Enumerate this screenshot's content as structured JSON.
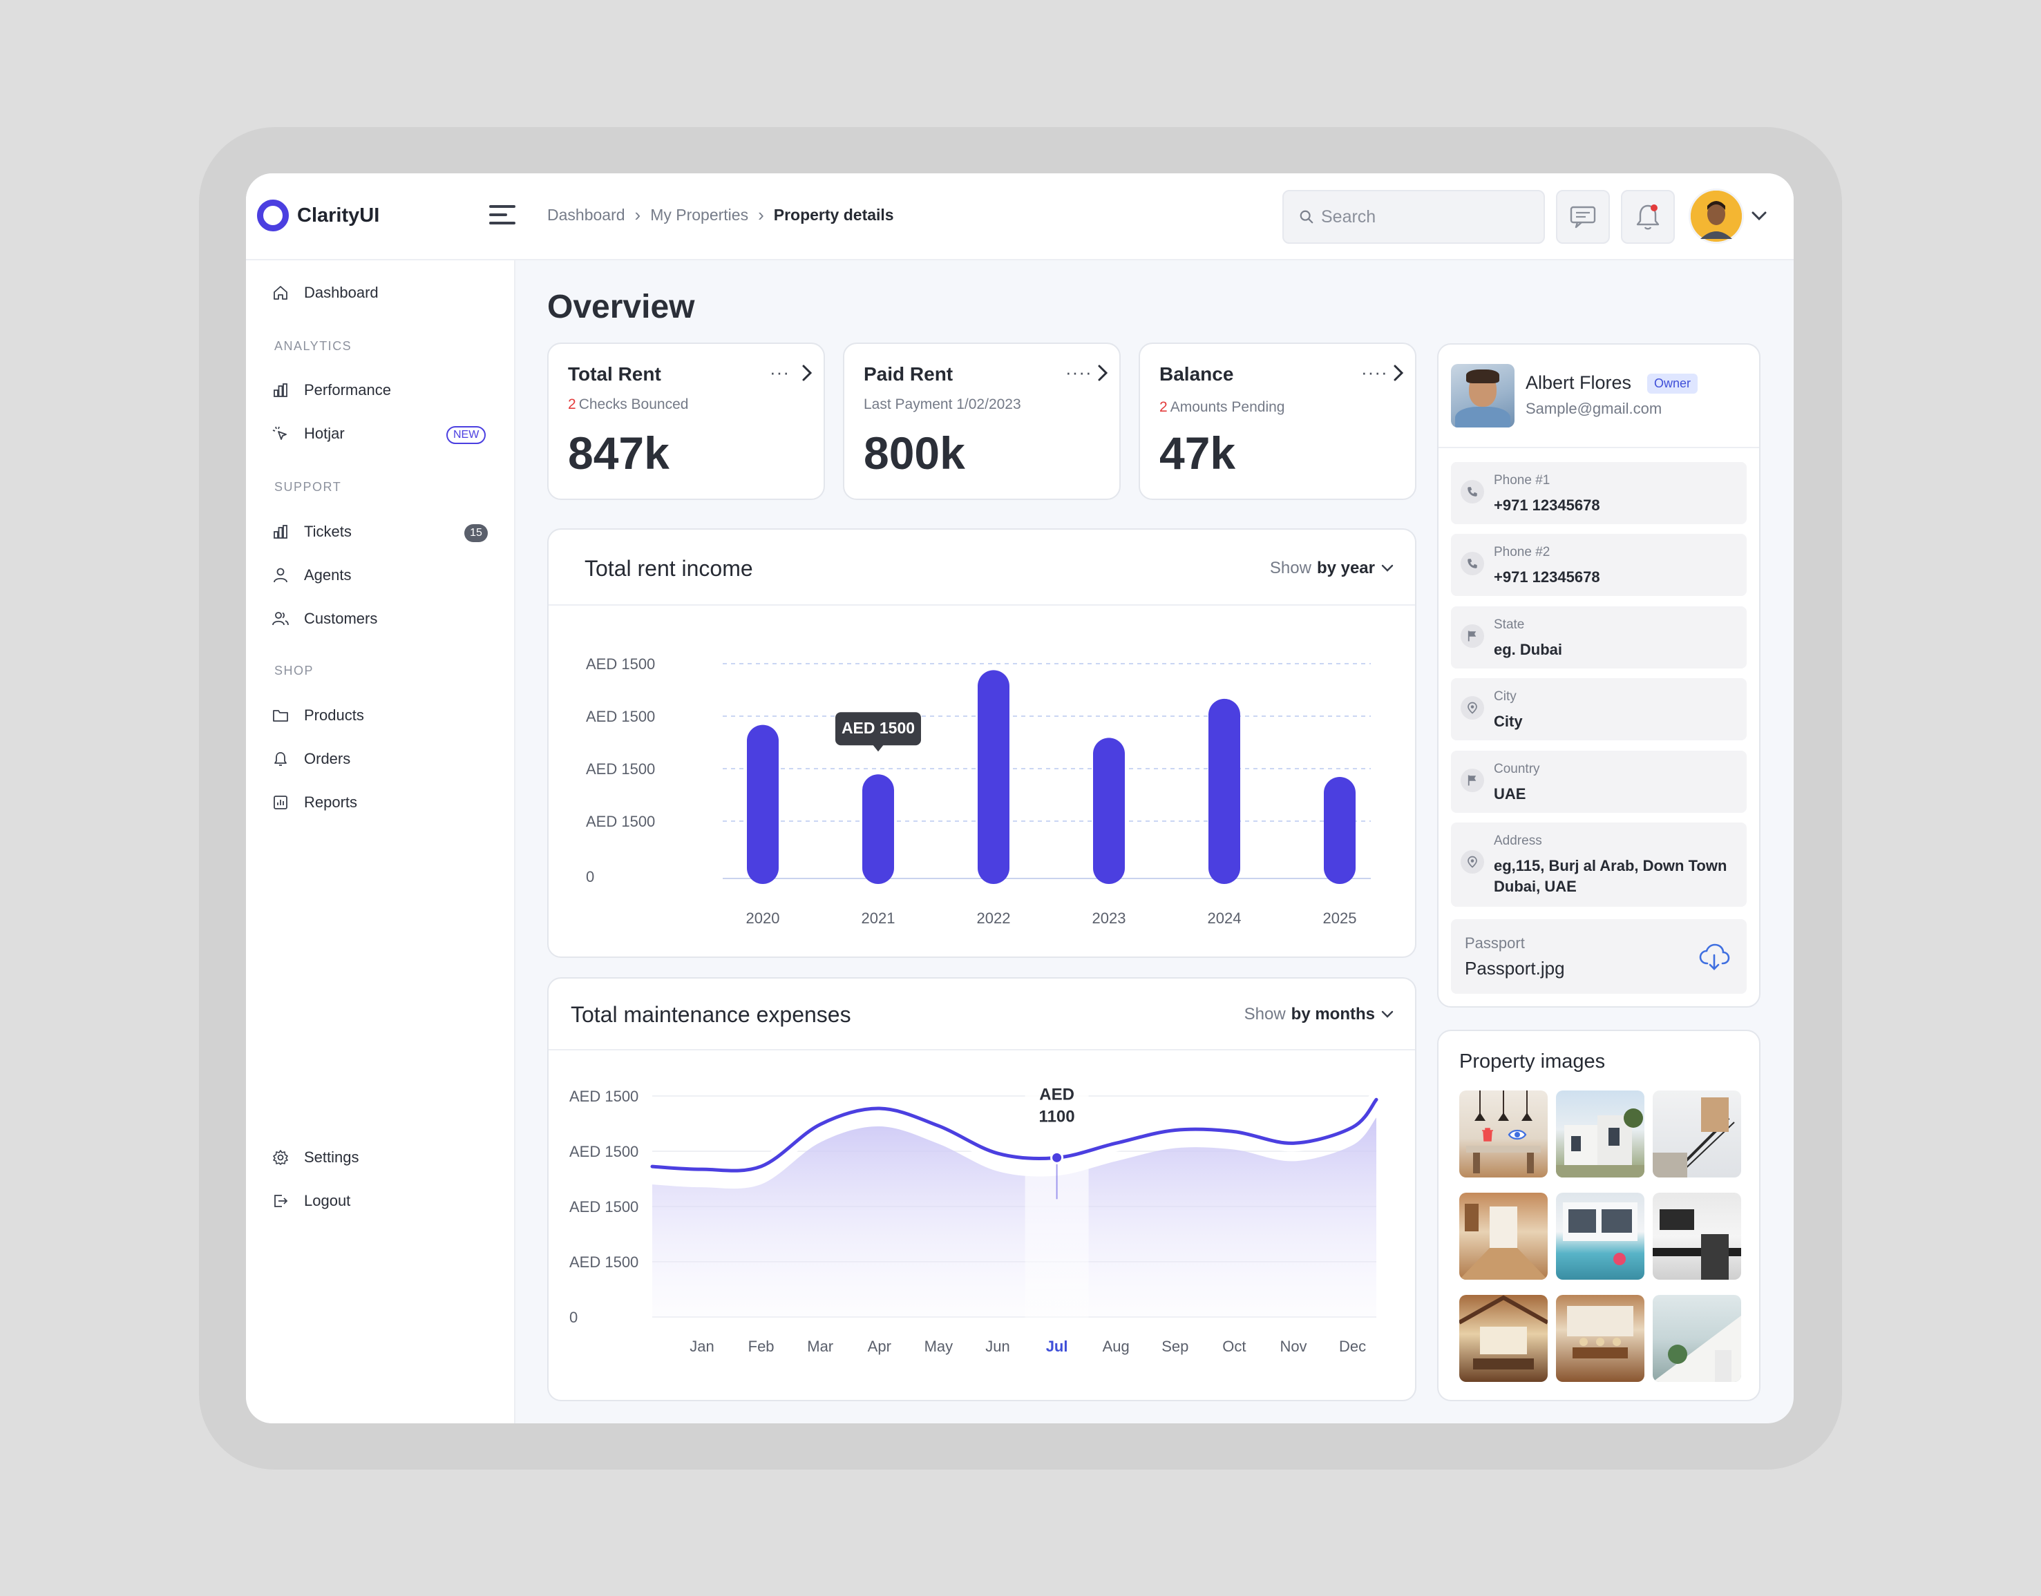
{
  "app": {
    "name": "ClarityUI",
    "brand_color": "#4b3fe0"
  },
  "breadcrumb": {
    "items": [
      "Dashboard",
      "My Properties"
    ],
    "current": "Property details"
  },
  "search": {
    "placeholder": "Search"
  },
  "sidebar": {
    "dashboard": "Dashboard",
    "sections": {
      "analytics": "ANALYTICS",
      "support": "SUPPORT",
      "shop": "SHOP"
    },
    "items": {
      "performance": "Performance",
      "hotjar": "Hotjar",
      "hotjar_badge": "NEW",
      "tickets": "Tickets",
      "tickets_count": "15",
      "agents": "Agents",
      "customers": "Customers",
      "products": "Products",
      "orders": "Orders",
      "reports": "Reports",
      "settings": "Settings",
      "logout": "Logout"
    }
  },
  "page": {
    "title": "Overview"
  },
  "stats": [
    {
      "title": "Total Rent",
      "sub_count": "2",
      "sub_text": "Checks Bounced",
      "value": "847k"
    },
    {
      "title": "Paid Rent",
      "sub_count": "",
      "sub_text": "Last Payment  1/02/2023",
      "value": "800k"
    },
    {
      "title": "Balance",
      "sub_count": "2",
      "sub_text": "Amounts Pending",
      "value": "47k"
    }
  ],
  "income_card": {
    "title": "Total rent income",
    "show_label": "Show",
    "show_value": "by year",
    "tooltip": "AED 1500"
  },
  "expense_card": {
    "title": "Total maintenance expenses",
    "show_label": "Show",
    "show_value": "by months",
    "tooltip_line1": "AED",
    "tooltip_line2": "1100",
    "active_month": "Jul"
  },
  "chart_data": [
    {
      "type": "bar",
      "title": "Total rent income",
      "categories": [
        "2020",
        "2021",
        "2022",
        "2023",
        "2024",
        "2025"
      ],
      "values": [
        1180,
        800,
        1600,
        1080,
        1380,
        780
      ],
      "y_tick_labels": [
        "AED 1500",
        "AED 1500",
        "AED 1500",
        "AED 1500",
        "0"
      ],
      "ylim": [
        0,
        1650
      ],
      "grid": true,
      "bar_color": "#4b3fe0"
    },
    {
      "type": "area",
      "title": "Total maintenance expenses",
      "categories": [
        "Jan",
        "Feb",
        "Mar",
        "Apr",
        "May",
        "Jun",
        "Jul",
        "Aug",
        "Sep",
        "Oct",
        "Nov",
        "Dec"
      ],
      "values": [
        1020,
        1040,
        1330,
        1440,
        1320,
        1130,
        1100,
        1200,
        1290,
        1280,
        1200,
        1310
      ],
      "y_tick_labels": [
        "AED 1500",
        "AED 1500",
        "AED 1500",
        "AED 1500",
        "0"
      ],
      "ylim": [
        0,
        1650
      ],
      "grid": true,
      "line_color": "#4b3fe0"
    }
  ],
  "owner": {
    "name": "Albert Flores",
    "role": "Owner",
    "email": "Sample@gmail.com",
    "fields": [
      {
        "label": "Phone #1",
        "value": "+971 12345678",
        "icon": "phone-icon"
      },
      {
        "label": "Phone #2",
        "value": "+971 12345678",
        "icon": "phone-icon"
      },
      {
        "label": "State",
        "value": "eg. Dubai",
        "icon": "flag-icon"
      },
      {
        "label": "City",
        "value": "City",
        "icon": "location-icon"
      },
      {
        "label": "Country",
        "value": "UAE",
        "icon": "flag-icon"
      },
      {
        "label": "Address",
        "value": "eg,115, Burj al Arab, Down Town Dubai, UAE",
        "icon": "location-icon"
      }
    ],
    "passport_label": "Passport",
    "passport_file": "Passport.jpg"
  },
  "property_images": {
    "title": "Property images",
    "count": 9
  }
}
